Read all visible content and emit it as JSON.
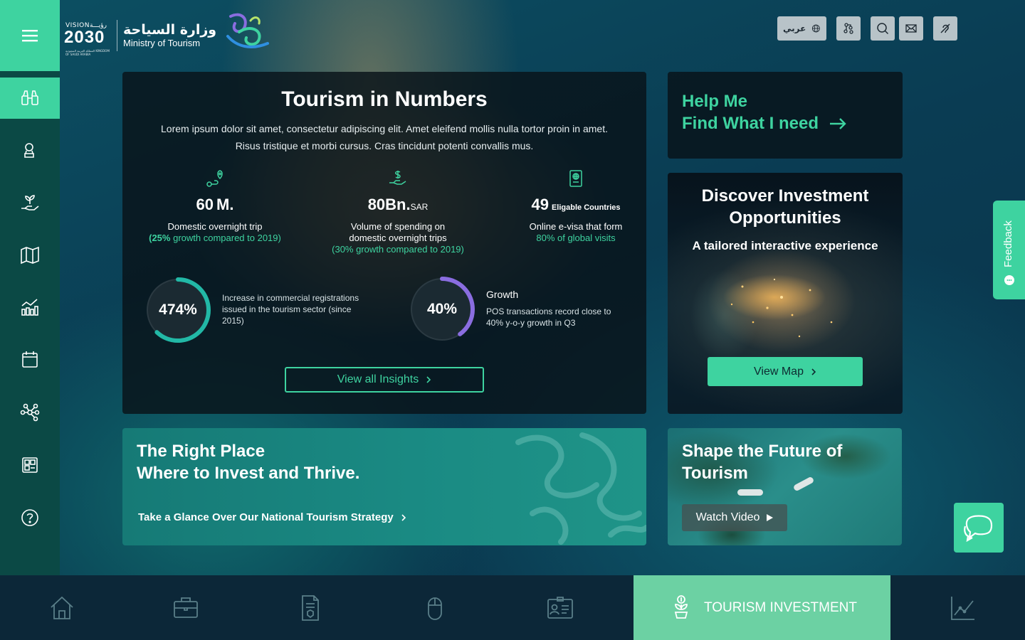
{
  "header": {
    "vision_label": "VISION",
    "vision_arabic": "رؤيـــة",
    "vision_number": "2030",
    "vision_sub": "المملكة العربية السعودية KINGDOM OF SAUDI ARABIA",
    "ministry_ar": "وزارة السياحة",
    "ministry_en": "Ministry of Tourism",
    "lang_label": "عربي",
    "tools": [
      "translate-icon",
      "sitemap-icon",
      "search-icon",
      "mail-icon",
      "hearing-icon"
    ]
  },
  "sidebar": {
    "items": [
      "binoculars-icon",
      "certificate-icon",
      "plant-hand-icon",
      "map-icon",
      "chart-icon",
      "calendar-icon",
      "network-icon",
      "dashboard-icon",
      "help-icon"
    ],
    "active_index": 0
  },
  "numbers": {
    "title": "Tourism in Numbers",
    "lead": "Lorem ipsum dolor sit amet, consectetur adipiscing elit. Amet eleifend mollis nulla tortor proin in amet. Risus tristique et morbi cursus. Cras tincidunt potenti convallis mus.",
    "stats": [
      {
        "value": "60",
        "unit": "M.",
        "label": "Domestic overnight trip",
        "sub_bold": "(25%",
        "sub": " growth compared to 2019)",
        "icon": "route-pin-icon"
      },
      {
        "value": "80",
        "unit": "Bn.",
        "unit2": "SAR",
        "label": "Volume of spending on domestic overnight trips",
        "sub": "(30% growth compared to 2019)",
        "icon": "money-hand-icon"
      },
      {
        "value": "49",
        "unit": "Eligable Countries",
        "label": "Online e-visa that form",
        "sub": "80% of global visits",
        "icon": "passport-icon"
      }
    ],
    "rings": [
      {
        "percent": "474%",
        "fill": 0.62,
        "color": "#22b8a6",
        "heading": "",
        "text": "Increase in commercial registrations issued in the tourism sector (since 2015)"
      },
      {
        "percent": "40%",
        "fill": 0.4,
        "color": "#8a6de0",
        "heading": "Growth",
        "text": "POS transactions record close to 40% y-o-y growth in Q3"
      }
    ],
    "insights_button": "View all Insights"
  },
  "help": {
    "line1": "Help Me",
    "line2": "Find What I need"
  },
  "discover": {
    "title": "Discover Investment Opportunities",
    "subtitle": "A tailored interactive experience",
    "button": "View Map"
  },
  "place": {
    "line1": "The Right Place",
    "line2": "Where to Invest and Thrive.",
    "link": "Take a Glance Over Our National Tourism Strategy"
  },
  "shape": {
    "line1": "Shape the Future of",
    "line2": "Tourism",
    "button": "Watch Video"
  },
  "feedback": {
    "label": "Feedback"
  },
  "bottom_nav": {
    "items": [
      "home-icon",
      "briefcase-icon",
      "document-icon",
      "mouse-icon",
      "id-card-icon",
      "tourism-investment-icon",
      "line-chart-icon"
    ],
    "active_label": "TOURISM INVESTMENT",
    "active_index": 5
  },
  "colors": {
    "accent": "#3ed3a0",
    "sidebar": "#0b4945",
    "panel": "#08121a",
    "ring_teal": "#22b8a6",
    "ring_purple": "#8a6de0"
  }
}
